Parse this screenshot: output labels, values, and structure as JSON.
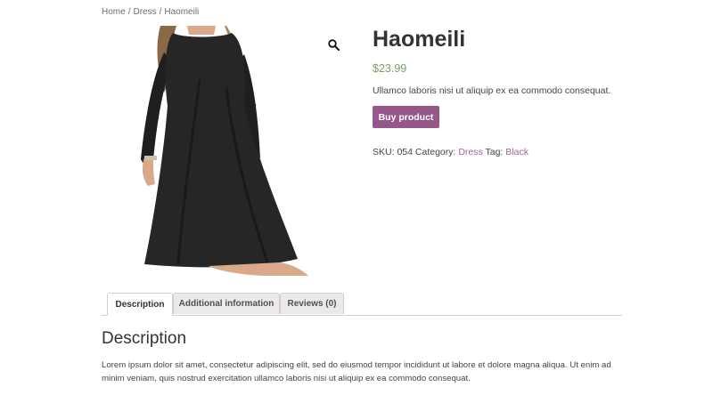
{
  "breadcrumb": {
    "home": "Home",
    "category": "Dress",
    "current": "Haomeili",
    "separator": "/"
  },
  "gallery": {
    "zoom_icon": "magnifier-icon",
    "image_alt": "Haomeili"
  },
  "product": {
    "title": "Haomeili",
    "price": "$23.99",
    "short_description": "Ullamco laboris nisi ut aliquip ex ea commodo consequat.",
    "buy_label": "Buy product",
    "sku_label": "SKU:",
    "sku_value": "054",
    "category_label": "Category:",
    "category_value": "Dress",
    "tag_label": "Tag:",
    "tag_value": "Black"
  },
  "tabs": [
    {
      "label": "Description"
    },
    {
      "label": "Additional information"
    },
    {
      "label": "Reviews (0)"
    }
  ],
  "description": {
    "heading": "Description",
    "body": "Lorem ipsum dolor sit amet, consectetur adipiscing elit, sed do eiusmod tempor incididunt ut labore et dolore magna aliqua. Ut enim ad minim veniam, quis nostrud exercitation ullamco laboris nisi ut aliquip ex ea commodo consequat."
  },
  "colors": {
    "accent": "#96588a",
    "price": "#77a464",
    "link": "#a46497"
  }
}
